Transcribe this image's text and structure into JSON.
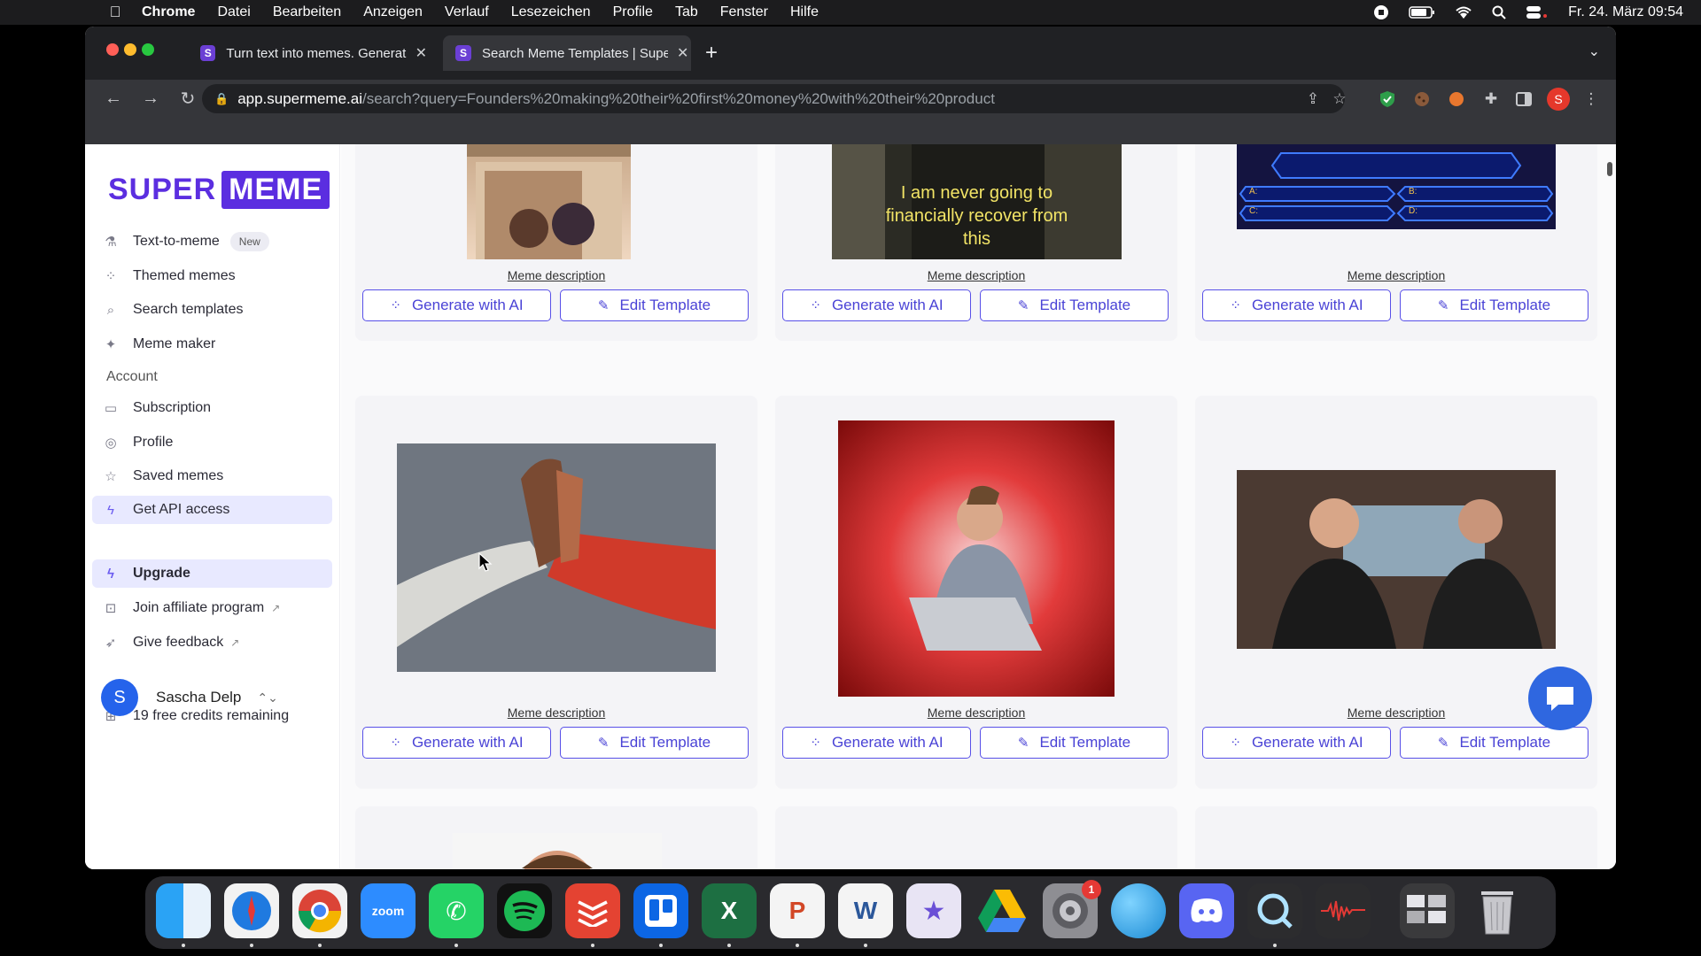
{
  "menubar": {
    "app": "Chrome",
    "menus": [
      "Datei",
      "Bearbeiten",
      "Anzeigen",
      "Verlauf",
      "Lesezeichen",
      "Profile",
      "Tab",
      "Fenster",
      "Hilfe"
    ],
    "datetime": "Fr. 24. März  09:54"
  },
  "browser": {
    "tabs": [
      {
        "title": "Turn text into memes. Generat",
        "favicon": "S"
      },
      {
        "title": "Search Meme Templates | Supe",
        "favicon": "S"
      }
    ],
    "url_host": "app.supermeme.ai",
    "url_path": "/search?query=Founders%20making%20their%20first%20money%20with%20their%20product",
    "profile_initial": "S"
  },
  "sidebar": {
    "logo_super": "SUPER",
    "logo_meme": "MEME",
    "main_items": [
      {
        "label": "Text-to-meme",
        "icon": "flask-icon",
        "badge": "New"
      },
      {
        "label": "Themed memes",
        "icon": "sparkle-loader-icon"
      },
      {
        "label": "Search templates",
        "icon": "search-icon"
      },
      {
        "label": "Meme maker",
        "icon": "magic-wand-icon"
      }
    ],
    "account_label": "Account",
    "account_items": [
      {
        "label": "Subscription",
        "icon": "card-icon"
      },
      {
        "label": "Profile",
        "icon": "user-circle-icon"
      },
      {
        "label": "Saved memes",
        "icon": "star-icon"
      },
      {
        "label": "Get API access",
        "icon": "bolt-icon"
      }
    ],
    "upgrade_label": "Upgrade",
    "extra_items": [
      {
        "label": "Join affiliate program",
        "icon": "affiliate-icon"
      },
      {
        "label": "Give feedback",
        "icon": "rocket-icon"
      }
    ],
    "credits": "19 free credits remaining",
    "user_name": "Sascha Delp",
    "user_initial": "S"
  },
  "grid": {
    "description_label": "Meme description",
    "generate_label": "Generate with AI",
    "edit_label": "Edit Template",
    "caption_financially": "I am never going to financially recover from this",
    "quiz_answers": [
      "A:",
      "B:",
      "C:",
      "D:"
    ]
  },
  "colors": {
    "accent": "#5b2ee0",
    "button_border": "#5850e8",
    "active_bg": "#e8e9ff",
    "chat": "#2f67e0"
  }
}
